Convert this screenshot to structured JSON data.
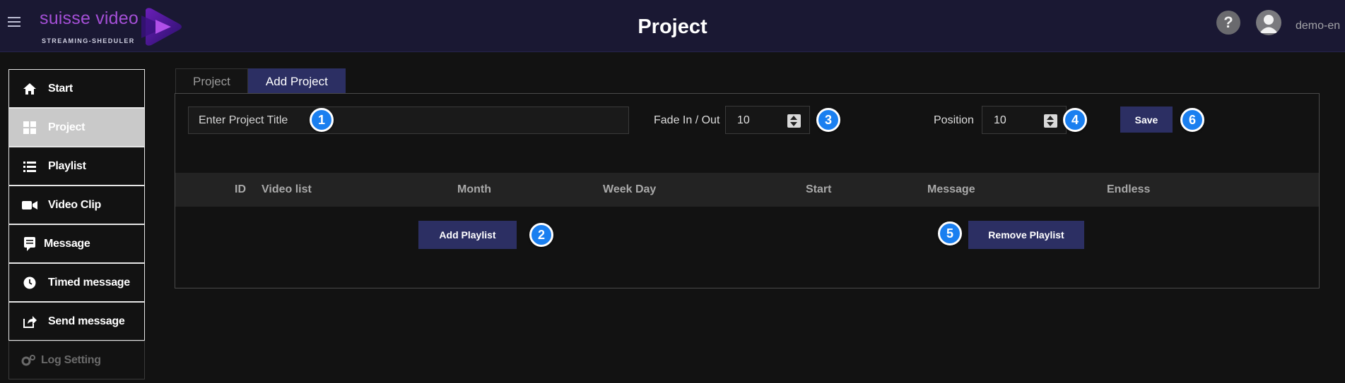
{
  "app": {
    "logo_text": "suisse video",
    "logo_subtext": "STREAMING-SHEDULER",
    "page_title": "Project",
    "help_label": "?",
    "username": "demo-en",
    "colors": {
      "topbar": "#1a1833",
      "accent": "#2c2f63",
      "badge": "#1a7ff0",
      "logo": "#a44fd6"
    }
  },
  "sidebar": {
    "items": [
      {
        "label": "Start",
        "icon": "home-icon"
      },
      {
        "label": "Project",
        "icon": "grid-icon"
      },
      {
        "label": "Playlist",
        "icon": "list-icon"
      },
      {
        "label": "Video Clip",
        "icon": "video-camera-icon"
      },
      {
        "label": "Message",
        "icon": "message-icon"
      },
      {
        "label": "Timed message",
        "icon": "clock-icon"
      },
      {
        "label": "Send message",
        "icon": "share-icon"
      },
      {
        "label": "Log Setting",
        "icon": "gears-icon"
      }
    ]
  },
  "tabs": [
    {
      "label": "Project"
    },
    {
      "label": "Add Project"
    }
  ],
  "form": {
    "title_placeholder": "Enter Project Title",
    "fade_label": "Fade In / Out",
    "fade_value": "10",
    "position_label": "Position",
    "position_value": "10",
    "save_label": "Save"
  },
  "table": {
    "columns": [
      "ID",
      "Video list",
      "Month",
      "Week Day",
      "Start",
      "Message",
      "Endless"
    ]
  },
  "actions": {
    "add_playlist_label": "Add Playlist",
    "remove_playlist_label": "Remove Playlist"
  },
  "badges": [
    "1",
    "2",
    "3",
    "4",
    "5",
    "6"
  ]
}
